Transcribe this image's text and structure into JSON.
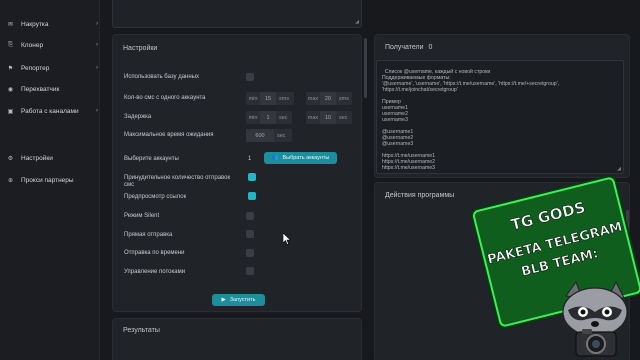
{
  "sidebar": {
    "items": [
      {
        "label": "Накрутка",
        "icon": "megaphone-icon",
        "glyph": "✉",
        "chevron": "›"
      },
      {
        "label": "Клонер",
        "icon": "clone-icon",
        "glyph": "⎘",
        "chevron": "›"
      },
      {
        "label": "Репортер",
        "icon": "flag-icon",
        "glyph": "⚑",
        "chevron": "›"
      },
      {
        "label": "Перехватчик",
        "icon": "eye-icon",
        "glyph": "◉",
        "chevron": ""
      },
      {
        "label": "Работа с каналами",
        "icon": "briefcase-icon",
        "glyph": "▣",
        "chevron": "›"
      },
      {
        "label": "Настройки",
        "icon": "gear-icon",
        "glyph": "⚙",
        "chevron": ""
      },
      {
        "label": "Прокси партнеры",
        "icon": "globe-icon",
        "glyph": "⊕",
        "chevron": ""
      }
    ]
  },
  "settings": {
    "title": "Настройки",
    "use_db_label": "Использовать базу данных",
    "sms_count_label": "Кол-во смс с одного аккаунта",
    "sms_min_prefix": "min",
    "sms_min_value": "15",
    "sms_min_suffix": "sms",
    "sms_max_prefix": "max",
    "sms_max_value": "20",
    "sms_max_suffix": "sms",
    "delay_label": "Задержка",
    "delay_min_prefix": "min",
    "delay_min_value": "1",
    "delay_min_suffix": "sec",
    "delay_max_prefix": "max",
    "delay_max_value": "10",
    "delay_max_suffix": "sec",
    "max_wait_label": "Максимальное время ожидания",
    "max_wait_value": "600",
    "max_wait_suffix": "sec",
    "choose_accounts_label": "Выберите аккаунты",
    "accounts_count": "1",
    "choose_accounts_button": "Выбрать аккаунты",
    "force_count_label_1": "Принудительное количество отправок",
    "force_count_label_2": "смс",
    "preview_links_label": "Предпросмотр ссылок",
    "silent_label": "Режим Silent",
    "direct_send_label": "Прямая отправка",
    "send_by_time_label": "Отправка по времени",
    "thread_control_label": "Управление потоками",
    "start_button": "Запустить"
  },
  "toggles": {
    "use_db": false,
    "force_count": true,
    "preview_links": true,
    "silent": false,
    "direct_send": false,
    "send_by_time": false,
    "thread_control": false
  },
  "results": {
    "title": "Результаты"
  },
  "recipients": {
    "title": "Получатели",
    "count": "0",
    "text": "Список @username, каждый с новой строки\nПоддерживаемые форматы:\n'@username', 'username', 'https://t.me/username', 'https://t.me/+secretgroup',\n'https://t.me/joinchat/secretgroup'\n\nПример\nusername1\nusername2\nusername3\n\n@username1\n@username2\n@username3\n\nhttps://t.me/username1\nhttps://t.me/username2\nhttps://t.me/username3"
  },
  "actions": {
    "title": "Действия программы",
    "clear_icon": "trash-icon"
  },
  "watermark": {
    "line1": "TG GODS",
    "line2": "PAKETA TELEGRAM",
    "line3": "BLB TEAM:",
    "line4": "",
    "colors": {
      "slab": "#0f5e1e",
      "outline": "#3df05a"
    }
  },
  "colors": {
    "accent": "#25b5c7",
    "button": "#1d8e9b",
    "panel": "#202328",
    "background": "#17191d"
  }
}
